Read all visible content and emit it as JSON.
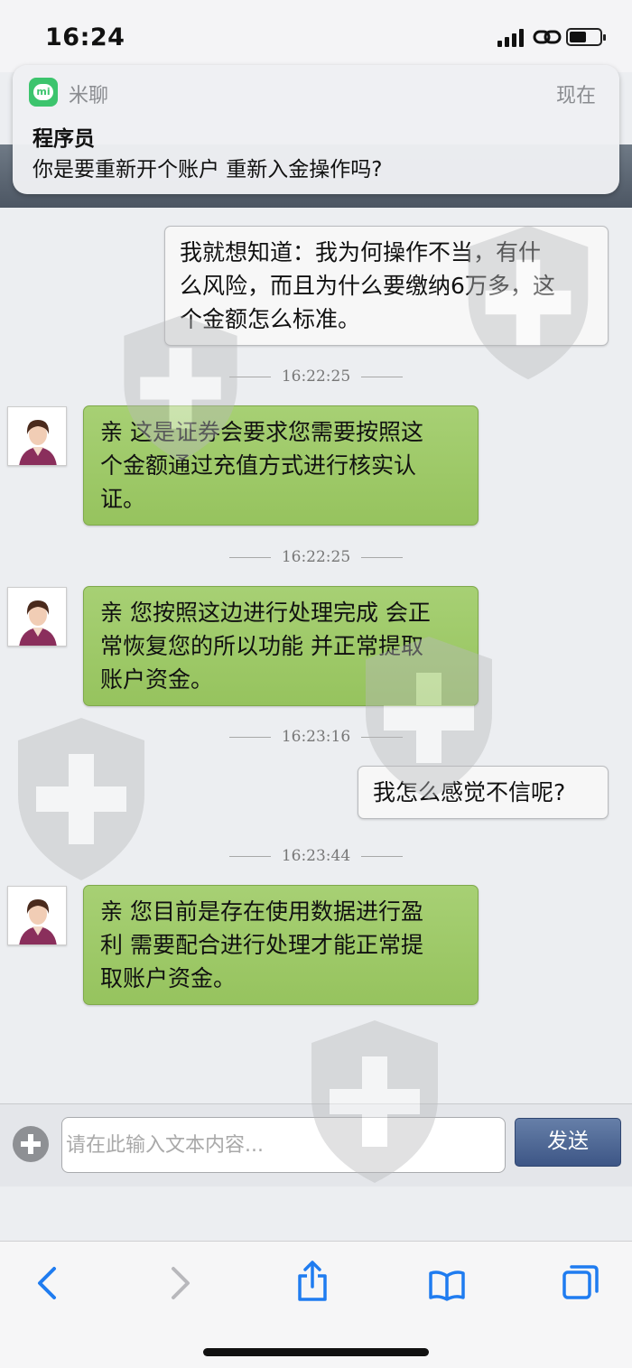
{
  "status_bar": {
    "time": "16:24"
  },
  "notification": {
    "app_name": "米聊",
    "app_icon": "mi",
    "time": "现在",
    "title": "程序员",
    "body": "你是要重新开个账户 重新入金操作吗?"
  },
  "messages": [
    {
      "direction": "out",
      "lines": [
        "我就想知道：我为何操作不当，有什",
        "么风险，而且为什么要缴纳6万多，这",
        "个金额怎么标准。"
      ]
    },
    {
      "timestamp": "16:22:25"
    },
    {
      "direction": "in",
      "lines": [
        "亲 这是证券会要求您需要按照这",
        "个金额通过充值方式进行核实认",
        "证。"
      ]
    },
    {
      "timestamp": "16:22:25"
    },
    {
      "direction": "in",
      "lines": [
        "亲 您按照这边进行处理完成 会正",
        "常恢复您的所以功能 并正常提取",
        "账户资金。"
      ]
    },
    {
      "timestamp": "16:23:16"
    },
    {
      "direction": "out",
      "lines": [
        "我怎么感觉不信呢?"
      ]
    },
    {
      "timestamp": "16:23:44"
    },
    {
      "direction": "in",
      "lines": [
        "亲 您目前是存在使用数据进行盈",
        "利 需要配合进行处理才能正常提",
        "取账户资金。"
      ]
    }
  ],
  "composer": {
    "placeholder": "请在此输入文本内容...",
    "send_label": "发送"
  },
  "colors": {
    "incoming_bubble": "#9ec869",
    "outgoing_bubble": "#f7f7f7",
    "send_button": "#4a6493"
  },
  "browser_toolbar": {
    "icons": [
      "back-icon",
      "forward-icon",
      "share-icon",
      "bookmarks-icon",
      "tabs-icon"
    ]
  }
}
